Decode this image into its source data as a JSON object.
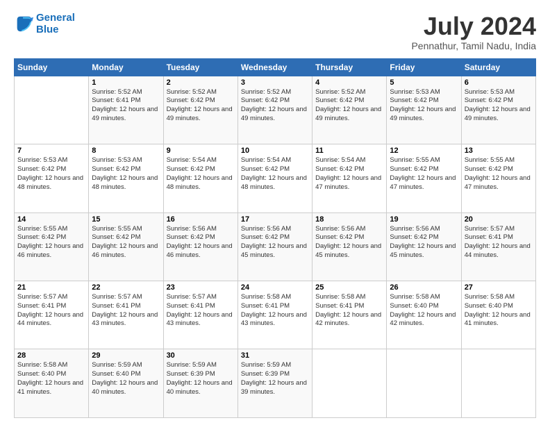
{
  "logo": {
    "line1": "General",
    "line2": "Blue"
  },
  "title": "July 2024",
  "subtitle": "Pennathur, Tamil Nadu, India",
  "header_days": [
    "Sunday",
    "Monday",
    "Tuesday",
    "Wednesday",
    "Thursday",
    "Friday",
    "Saturday"
  ],
  "weeks": [
    [
      {
        "day": "",
        "info": ""
      },
      {
        "day": "1",
        "info": "Sunrise: 5:52 AM\nSunset: 6:41 PM\nDaylight: 12 hours\nand 49 minutes."
      },
      {
        "day": "2",
        "info": "Sunrise: 5:52 AM\nSunset: 6:42 PM\nDaylight: 12 hours\nand 49 minutes."
      },
      {
        "day": "3",
        "info": "Sunrise: 5:52 AM\nSunset: 6:42 PM\nDaylight: 12 hours\nand 49 minutes."
      },
      {
        "day": "4",
        "info": "Sunrise: 5:52 AM\nSunset: 6:42 PM\nDaylight: 12 hours\nand 49 minutes."
      },
      {
        "day": "5",
        "info": "Sunrise: 5:53 AM\nSunset: 6:42 PM\nDaylight: 12 hours\nand 49 minutes."
      },
      {
        "day": "6",
        "info": "Sunrise: 5:53 AM\nSunset: 6:42 PM\nDaylight: 12 hours\nand 49 minutes."
      }
    ],
    [
      {
        "day": "7",
        "info": "Sunrise: 5:53 AM\nSunset: 6:42 PM\nDaylight: 12 hours\nand 48 minutes."
      },
      {
        "day": "8",
        "info": "Sunrise: 5:53 AM\nSunset: 6:42 PM\nDaylight: 12 hours\nand 48 minutes."
      },
      {
        "day": "9",
        "info": "Sunrise: 5:54 AM\nSunset: 6:42 PM\nDaylight: 12 hours\nand 48 minutes."
      },
      {
        "day": "10",
        "info": "Sunrise: 5:54 AM\nSunset: 6:42 PM\nDaylight: 12 hours\nand 48 minutes."
      },
      {
        "day": "11",
        "info": "Sunrise: 5:54 AM\nSunset: 6:42 PM\nDaylight: 12 hours\nand 47 minutes."
      },
      {
        "day": "12",
        "info": "Sunrise: 5:55 AM\nSunset: 6:42 PM\nDaylight: 12 hours\nand 47 minutes."
      },
      {
        "day": "13",
        "info": "Sunrise: 5:55 AM\nSunset: 6:42 PM\nDaylight: 12 hours\nand 47 minutes."
      }
    ],
    [
      {
        "day": "14",
        "info": "Sunrise: 5:55 AM\nSunset: 6:42 PM\nDaylight: 12 hours\nand 46 minutes."
      },
      {
        "day": "15",
        "info": "Sunrise: 5:55 AM\nSunset: 6:42 PM\nDaylight: 12 hours\nand 46 minutes."
      },
      {
        "day": "16",
        "info": "Sunrise: 5:56 AM\nSunset: 6:42 PM\nDaylight: 12 hours\nand 46 minutes."
      },
      {
        "day": "17",
        "info": "Sunrise: 5:56 AM\nSunset: 6:42 PM\nDaylight: 12 hours\nand 45 minutes."
      },
      {
        "day": "18",
        "info": "Sunrise: 5:56 AM\nSunset: 6:42 PM\nDaylight: 12 hours\nand 45 minutes."
      },
      {
        "day": "19",
        "info": "Sunrise: 5:56 AM\nSunset: 6:42 PM\nDaylight: 12 hours\nand 45 minutes."
      },
      {
        "day": "20",
        "info": "Sunrise: 5:57 AM\nSunset: 6:41 PM\nDaylight: 12 hours\nand 44 minutes."
      }
    ],
    [
      {
        "day": "21",
        "info": "Sunrise: 5:57 AM\nSunset: 6:41 PM\nDaylight: 12 hours\nand 44 minutes."
      },
      {
        "day": "22",
        "info": "Sunrise: 5:57 AM\nSunset: 6:41 PM\nDaylight: 12 hours\nand 43 minutes."
      },
      {
        "day": "23",
        "info": "Sunrise: 5:57 AM\nSunset: 6:41 PM\nDaylight: 12 hours\nand 43 minutes."
      },
      {
        "day": "24",
        "info": "Sunrise: 5:58 AM\nSunset: 6:41 PM\nDaylight: 12 hours\nand 43 minutes."
      },
      {
        "day": "25",
        "info": "Sunrise: 5:58 AM\nSunset: 6:41 PM\nDaylight: 12 hours\nand 42 minutes."
      },
      {
        "day": "26",
        "info": "Sunrise: 5:58 AM\nSunset: 6:40 PM\nDaylight: 12 hours\nand 42 minutes."
      },
      {
        "day": "27",
        "info": "Sunrise: 5:58 AM\nSunset: 6:40 PM\nDaylight: 12 hours\nand 41 minutes."
      }
    ],
    [
      {
        "day": "28",
        "info": "Sunrise: 5:58 AM\nSunset: 6:40 PM\nDaylight: 12 hours\nand 41 minutes."
      },
      {
        "day": "29",
        "info": "Sunrise: 5:59 AM\nSunset: 6:40 PM\nDaylight: 12 hours\nand 40 minutes."
      },
      {
        "day": "30",
        "info": "Sunrise: 5:59 AM\nSunset: 6:39 PM\nDaylight: 12 hours\nand 40 minutes."
      },
      {
        "day": "31",
        "info": "Sunrise: 5:59 AM\nSunset: 6:39 PM\nDaylight: 12 hours\nand 39 minutes."
      },
      {
        "day": "",
        "info": ""
      },
      {
        "day": "",
        "info": ""
      },
      {
        "day": "",
        "info": ""
      }
    ]
  ]
}
